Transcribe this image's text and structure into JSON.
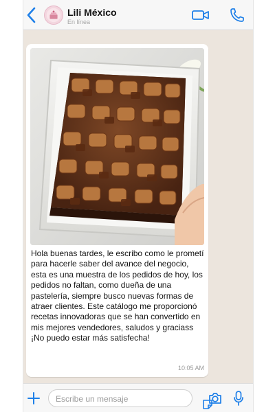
{
  "header": {
    "contact_name": "Lili México",
    "status": "En línea",
    "icons": {
      "back": "chevron-left-icon",
      "video": "video-camera-icon",
      "call": "phone-icon"
    },
    "accent_color": "#1E7FE8"
  },
  "message": {
    "image_alt": "Brownie con chocolates",
    "text": "Hola buenas tardes, le escribo como le prometí para hacerle saber del avance del negocio, esta es una muestra de los pedidos de hoy, los pedidos no faltan, como dueña de una pastelería, siempre busco nuevas formas de atraer clientes. Este catálogo me proporcionó recetas innovadoras que se han convertido en mis mejores vendedores, saludos y graciass ¡No puedo estar más satisfecha!",
    "time": "10:05 AM"
  },
  "input": {
    "placeholder": "Escribe un mensaje",
    "icons": {
      "add": "plus-icon",
      "sticker": "sticker-icon",
      "camera": "camera-icon",
      "mic": "microphone-icon"
    }
  }
}
